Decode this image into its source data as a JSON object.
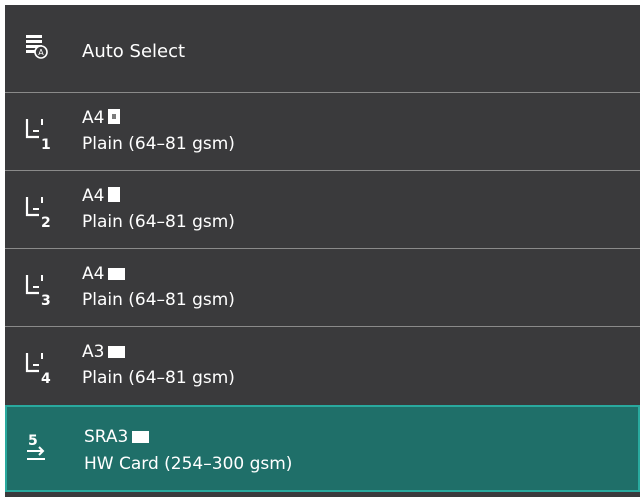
{
  "auto_select": {
    "label": "Auto Select",
    "icon": "auto-select-icon"
  },
  "trays": [
    {
      "number": "1",
      "size": "A4",
      "type": "Plain (64–81 gsm)",
      "orientation": "mixed"
    },
    {
      "number": "2",
      "size": "A4",
      "type": "Plain (64–81 gsm)",
      "orientation": "portrait"
    },
    {
      "number": "3",
      "size": "A4",
      "type": "Plain (64–81 gsm)",
      "orientation": "landscape"
    },
    {
      "number": "4",
      "size": "A3",
      "type": "Plain (64–81 gsm)",
      "orientation": "landscape"
    },
    {
      "number": "5",
      "size": "SRA3",
      "type": "HW Card (254–300 gsm)",
      "orientation": "landscape",
      "selected": true
    }
  ],
  "colors": {
    "background": "#3a3a3c",
    "selected": "#1f6f69",
    "selected_border": "#29a99e",
    "divider": "#8a8a8a"
  }
}
